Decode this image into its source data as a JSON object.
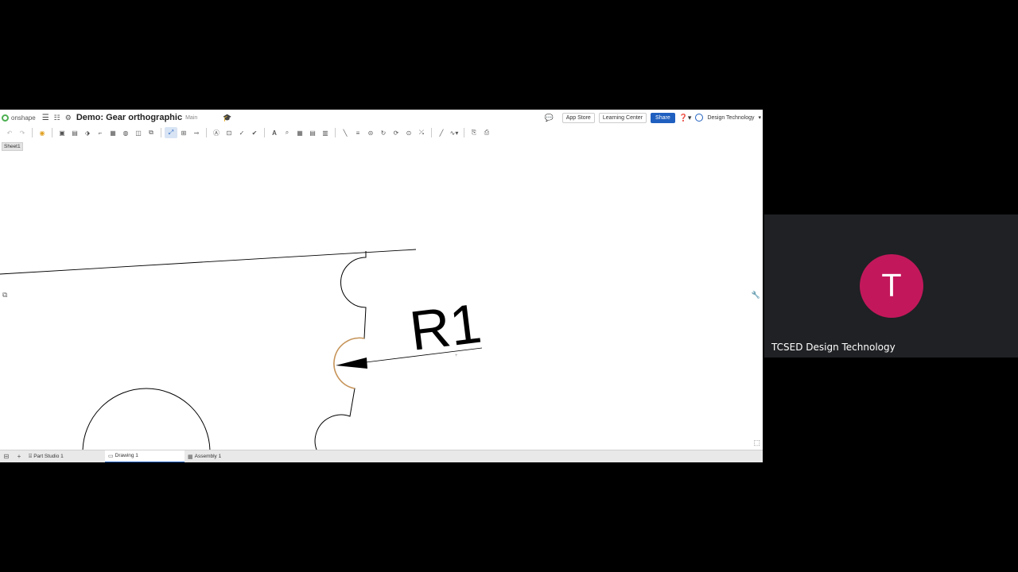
{
  "app": {
    "logo_text": "onshape",
    "document_title": "Demo: Gear orthographic",
    "branch": "Main"
  },
  "header": {
    "app_store": "App Store",
    "learning_center": "Learning Center",
    "share": "Share",
    "help": "?",
    "account": "Design Technology"
  },
  "sheet": {
    "tab_label": "Sheet1"
  },
  "drawing": {
    "dimension_label": "R1"
  },
  "bottom_tabs": [
    {
      "label": "Part Studio 1",
      "icon": "part-studio-icon"
    },
    {
      "label": "Drawing 1",
      "icon": "drawing-icon",
      "active": true
    },
    {
      "label": "Assembly 1",
      "icon": "assembly-icon"
    }
  ],
  "participant": {
    "initial": "T",
    "name": "TCSED Design Technology",
    "avatar_color": "#c2185b"
  },
  "colors": {
    "accent": "#1f5fbf",
    "highlight_arc": "#c8955a"
  }
}
